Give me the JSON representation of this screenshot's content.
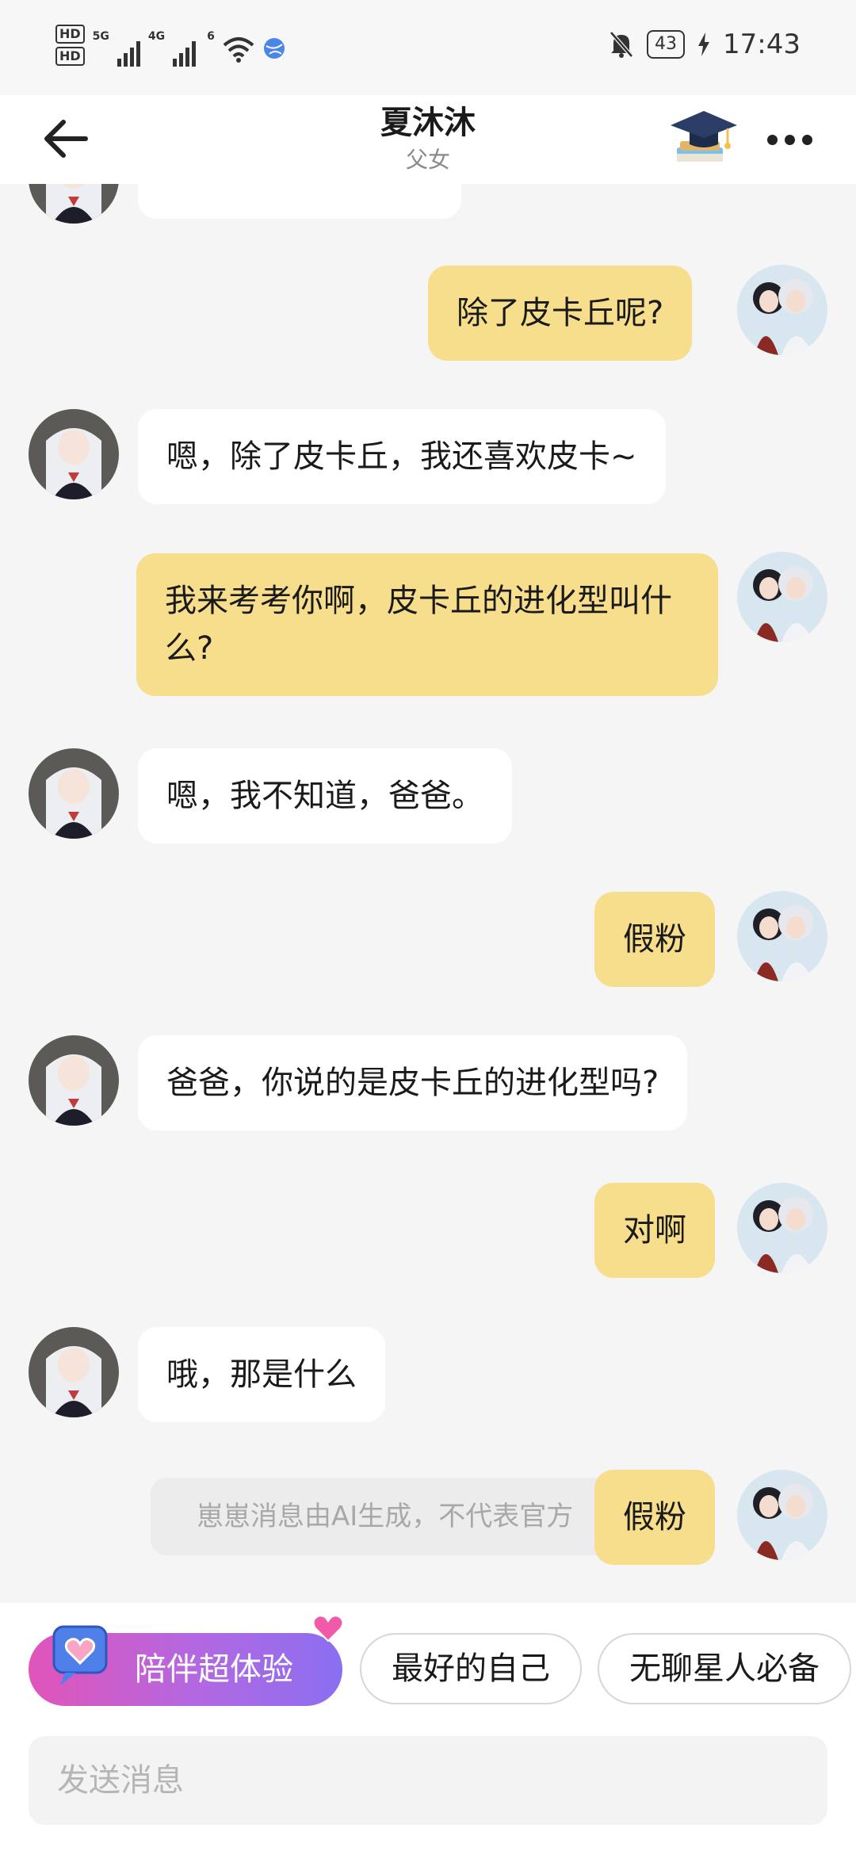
{
  "status_bar": {
    "hd1": "HD",
    "hd2": "HD",
    "net1": "5G",
    "net2": "4G",
    "wifi_badge": "6",
    "battery": "43",
    "time": "17:43"
  },
  "header": {
    "title": "夏沐沐",
    "subtitle": "父女"
  },
  "messages": [
    {
      "sender": "bot",
      "text": ""
    },
    {
      "sender": "me",
      "text": "除了皮卡丘呢?"
    },
    {
      "sender": "bot",
      "text": "嗯，除了皮卡丘，我还喜欢皮卡~"
    },
    {
      "sender": "me",
      "text": "我来考考你啊，皮卡丘的进化型叫什么?"
    },
    {
      "sender": "bot",
      "text": "嗯，我不知道，爸爸。"
    },
    {
      "sender": "me",
      "text": "假粉"
    },
    {
      "sender": "bot",
      "text": "爸爸，你说的是皮卡丘的进化型吗?"
    },
    {
      "sender": "me",
      "text": "对啊"
    },
    {
      "sender": "bot",
      "text": "哦，那是什么"
    },
    {
      "sender": "me",
      "text": "假粉"
    }
  ],
  "ai_notice": "崽崽消息由AI生成，不代表官方",
  "chips": [
    {
      "label": "陪伴超体验",
      "style": "gradient"
    },
    {
      "label": "最好的自己"
    },
    {
      "label": "无聊星人必备"
    }
  ],
  "compose": {
    "placeholder": "发送消息"
  },
  "colors": {
    "my_bubble": "#f7de8c",
    "bot_bubble": "#ffffff",
    "chip_gradient_start": "#e055b9",
    "chip_gradient_end": "#8a6ff0"
  }
}
